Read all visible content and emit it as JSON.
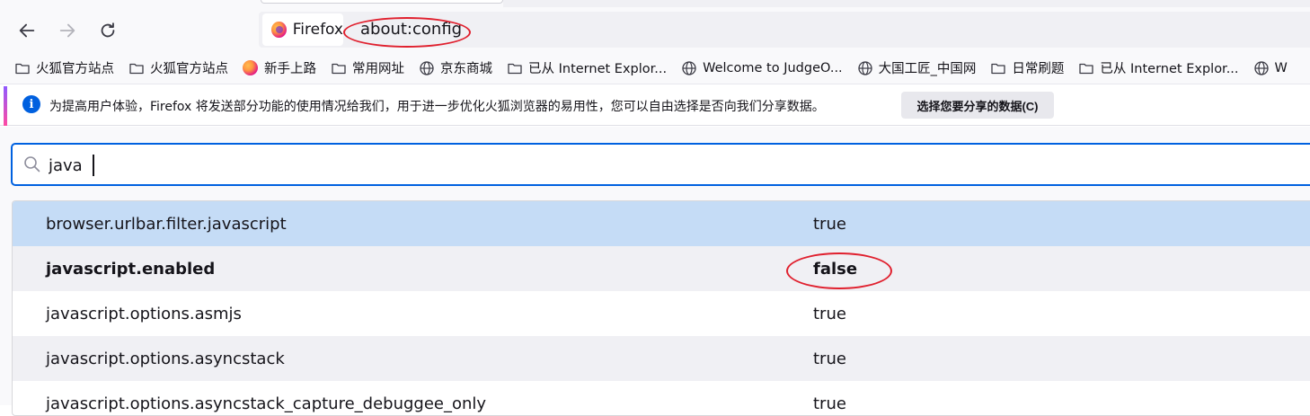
{
  "browser": {
    "identity_label": "Firefox",
    "url": "about:config"
  },
  "bookmarks": [
    {
      "label": "火狐官方站点",
      "icon": "folder-icon"
    },
    {
      "label": "火狐官方站点",
      "icon": "folder-icon"
    },
    {
      "label": "新手上路",
      "icon": "firefox-logo"
    },
    {
      "label": "常用网址",
      "icon": "folder-icon"
    },
    {
      "label": "京东商城",
      "icon": "globe-icon"
    },
    {
      "label": "已从 Internet Explor...",
      "icon": "folder-icon"
    },
    {
      "label": "Welcome to JudgeO...",
      "icon": "globe-icon"
    },
    {
      "label": "大国工匠_中国网",
      "icon": "globe-icon"
    },
    {
      "label": "日常刷题",
      "icon": "folder-icon"
    },
    {
      "label": "已从 Internet Explor...",
      "icon": "folder-icon"
    },
    {
      "label": "W",
      "icon": "globe-icon"
    }
  ],
  "notification": {
    "text": "为提高用户体验，Firefox 将发送部分功能的使用情况给我们，用于进一步优化火狐浏览器的易用性，您可以自由选择是否向我们分享数据。",
    "button_label": "选择您要分享的数据(C)",
    "info_glyph": "i"
  },
  "search": {
    "value": "java"
  },
  "prefs": [
    {
      "name": "browser.urlbar.filter.javascript",
      "value": "true",
      "modified": false,
      "selected": true
    },
    {
      "name": "javascript.enabled",
      "value": "false",
      "modified": true,
      "selected": false
    },
    {
      "name": "javascript.options.asmjs",
      "value": "true",
      "modified": false,
      "selected": false
    },
    {
      "name": "javascript.options.asyncstack",
      "value": "true",
      "modified": false,
      "selected": false
    },
    {
      "name": "javascript.options.asyncstack_capture_debuggee_only",
      "value": "true",
      "modified": false,
      "selected": false
    }
  ],
  "colors": {
    "annotation_red": "#e0202e",
    "selected_row": "#c5dcf6",
    "search_focus": "#0061e0"
  }
}
